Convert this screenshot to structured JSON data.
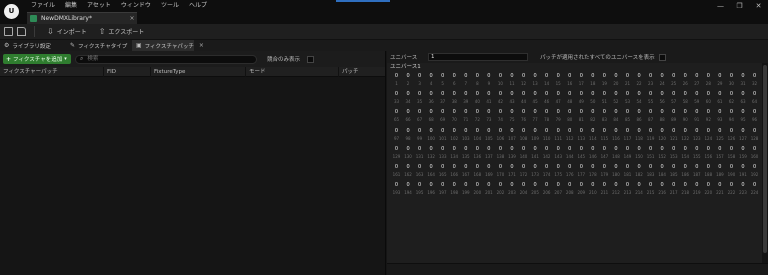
{
  "app": {
    "logo_text": "U",
    "menu": [
      "ファイル",
      "編集",
      "アセット",
      "ウィンドウ",
      "ツール",
      "ヘルプ"
    ],
    "window_controls": [
      "—",
      "❐",
      "✕"
    ],
    "accent_color": "#2f6fbf"
  },
  "document_tab": {
    "label": "NewDMXLibrary*",
    "close": "×"
  },
  "toolbar": {
    "import_label": "インポート",
    "export_label": "エクスポート"
  },
  "subtabs": [
    {
      "icon": "⚙",
      "label": "ライブラリ設定"
    },
    {
      "icon": "✎",
      "label": "フィクスチャタイプ"
    },
    {
      "icon": "▣",
      "label": "フィクスチャパッチ",
      "close": "×"
    }
  ],
  "patch_panel": {
    "add_button_icon": "+",
    "add_button_label": "フィクスチャを追加",
    "add_button_color": "#2f7d2f",
    "search_placeholder": "検索",
    "conflict_label": "競合のみ表示",
    "columns": [
      "フィクスチャーパッチ",
      "FID",
      "FixtureType",
      "モード",
      "パッチ"
    ]
  },
  "universe_panel": {
    "universe_label": "ユニバース",
    "universe_value": "1",
    "show_all_label": "パッチが適用されたすべてのユニバースを表示",
    "universe_header": "ユニバース1",
    "channel_value": "0",
    "channel_start": 1,
    "channel_end": 224,
    "columns_per_row": 32
  }
}
